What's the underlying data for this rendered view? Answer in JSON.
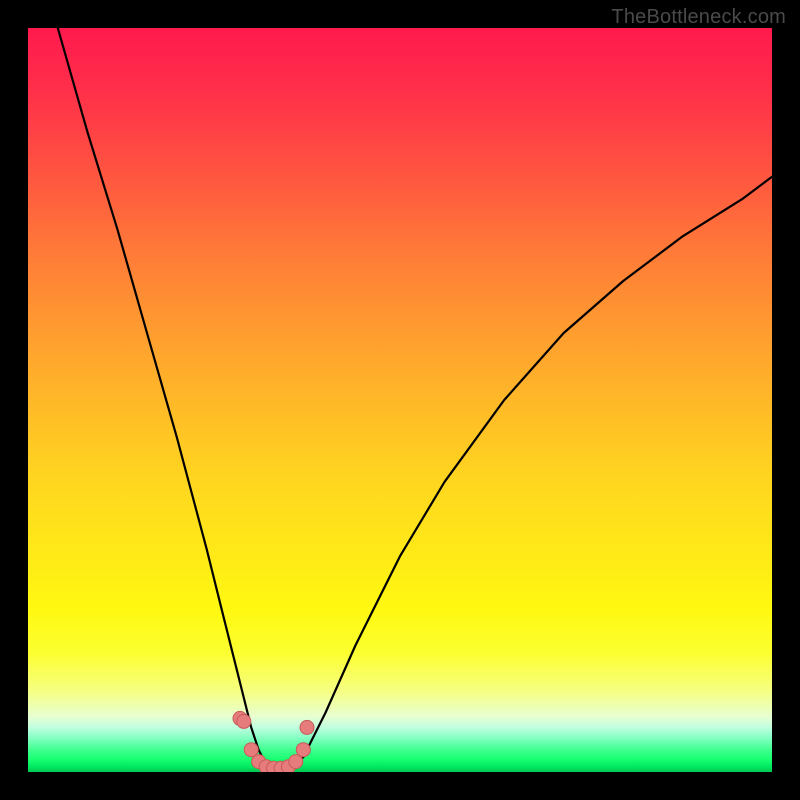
{
  "watermark": "TheBottleneck.com",
  "colors": {
    "frame": "#000000",
    "gradient_top": "#ff1a4d",
    "gradient_mid": "#ffe818",
    "gradient_bottom": "#00c850",
    "curve_stroke": "#000000",
    "dots_fill": "#e77c7c",
    "dots_stroke": "#c85a5a"
  },
  "chart_data": {
    "type": "line",
    "title": "",
    "xlabel": "",
    "ylabel": "",
    "xlim": [
      0,
      100
    ],
    "ylim": [
      0,
      100
    ],
    "note": "Visual bottleneck curve; y ≈ 100 at edges, dips to ≈0 at x ≈ 33. Values read from pixel heights (no axes/ticks present).",
    "series": [
      {
        "name": "bottleneck-curve",
        "x": [
          4,
          8,
          12,
          16,
          20,
          24,
          26,
          28,
          30,
          31,
          32,
          33,
          34,
          35,
          36,
          37,
          38,
          40,
          44,
          50,
          56,
          64,
          72,
          80,
          88,
          96,
          100
        ],
        "y": [
          100,
          86,
          73,
          59,
          45,
          30,
          22,
          14,
          6,
          3,
          1,
          0,
          0,
          0,
          1,
          2,
          4,
          8,
          17,
          29,
          39,
          50,
          59,
          66,
          72,
          77,
          80
        ]
      }
    ],
    "highlight_points": {
      "name": "dip-dots",
      "x": [
        28.5,
        29.0,
        30.0,
        31.0,
        32.0,
        33.0,
        34.0,
        35.0,
        36.0,
        37.0,
        37.5
      ],
      "y": [
        7.2,
        6.8,
        3.0,
        1.4,
        0.7,
        0.5,
        0.5,
        0.7,
        1.4,
        3.0,
        6.0
      ]
    }
  }
}
